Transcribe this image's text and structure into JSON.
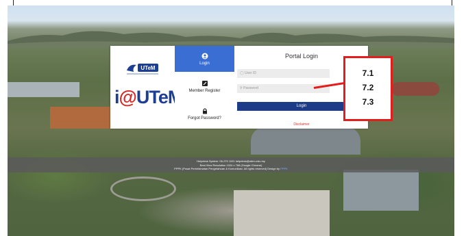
{
  "brand": {
    "small_logo_text": "UTeM",
    "big_logo_prefix": "i",
    "big_logo_at": "@",
    "big_logo_suffix": "UTeM"
  },
  "menu": {
    "items": [
      {
        "label": "Login",
        "icon": "user-icon",
        "active": true
      },
      {
        "label": "Member Register",
        "icon": "edit-icon",
        "active": false
      },
      {
        "label": "Forgot Password?",
        "icon": "lock-icon",
        "active": false
      }
    ]
  },
  "portal": {
    "title": "Portal Login",
    "user_placeholder": "User ID",
    "password_placeholder": "Password",
    "login_label": "Login",
    "disclaimer": "Disclaimer"
  },
  "footer": {
    "line1": "Helpdesk System: 06-270 1101  helpdesk@utem.edu.my",
    "line2": "Best View Resolution 1024 x 768 (Google Chrome)",
    "line3": "PPPK (Pusat Perkhidmatan Pengetahuan & Komunikasi. All rights reserved) Design by",
    "design_link": "PPPK"
  },
  "annotation": {
    "labels": [
      "7.1",
      "7.2",
      "7.3"
    ],
    "color": "#e31c1c"
  }
}
